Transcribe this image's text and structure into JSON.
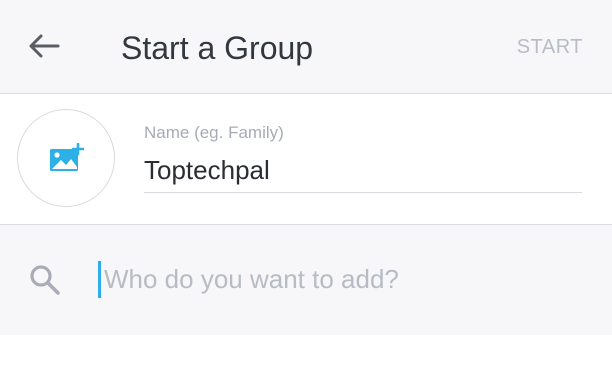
{
  "header": {
    "title": "Start a Group",
    "start_label": "START",
    "back_icon": "arrow-left-icon"
  },
  "group": {
    "name_label": "Name (eg. Family)",
    "name_value": "Toptechpal",
    "avatar_icon": "add-photo-icon"
  },
  "search": {
    "placeholder": "Who do you want to add?",
    "icon": "search-icon"
  },
  "colors": {
    "accent": "#2cb0e6",
    "header_bg": "#f7f7f9",
    "muted_text": "#b8bcc6",
    "title_text": "#333740"
  }
}
